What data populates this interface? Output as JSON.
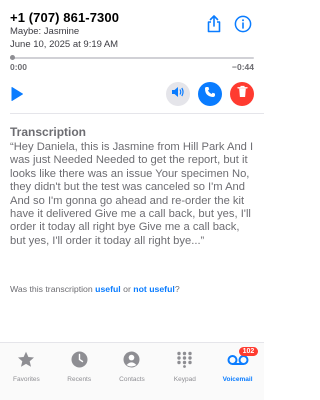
{
  "contact": {
    "phone": "+1 (707) 861-7300",
    "maybe": "Maybe: Jasmine",
    "date": "June 10, 2025 at 9:19 AM"
  },
  "player": {
    "elapsed": "0:00",
    "remaining": "−0:44",
    "progress": 0
  },
  "transcription": {
    "title": "Transcription",
    "text": "“Hey Daniela, this is Jasmine from Hill Park And I was just Needed Needed to get the report, but it looks like there was an issue Your specimen No, they didn't but the test was canceled so I'm And And so I'm gonna go ahead and re-order the kit have it delivered Give me a call back, but yes, I'll order it today all right bye Give me a call back, but yes, I'll order it today all right bye...”"
  },
  "feedback": {
    "prefix": "Was this transcription ",
    "useful": "useful",
    "or": " or ",
    "not_useful": "not useful",
    "suffix": "?"
  },
  "tabbar": {
    "tabs": [
      {
        "label": "Favorites",
        "icon": "star-icon"
      },
      {
        "label": "Recents",
        "icon": "clock-icon"
      },
      {
        "label": "Contacts",
        "icon": "person-icon"
      },
      {
        "label": "Keypad",
        "icon": "keypad-icon"
      },
      {
        "label": "Voicemail",
        "icon": "voicemail-icon",
        "badge": "102",
        "active": true
      }
    ]
  },
  "colors": {
    "accent": "#0a7cff",
    "destructive": "#ff3b30",
    "secondary_text": "#6d6d72"
  }
}
